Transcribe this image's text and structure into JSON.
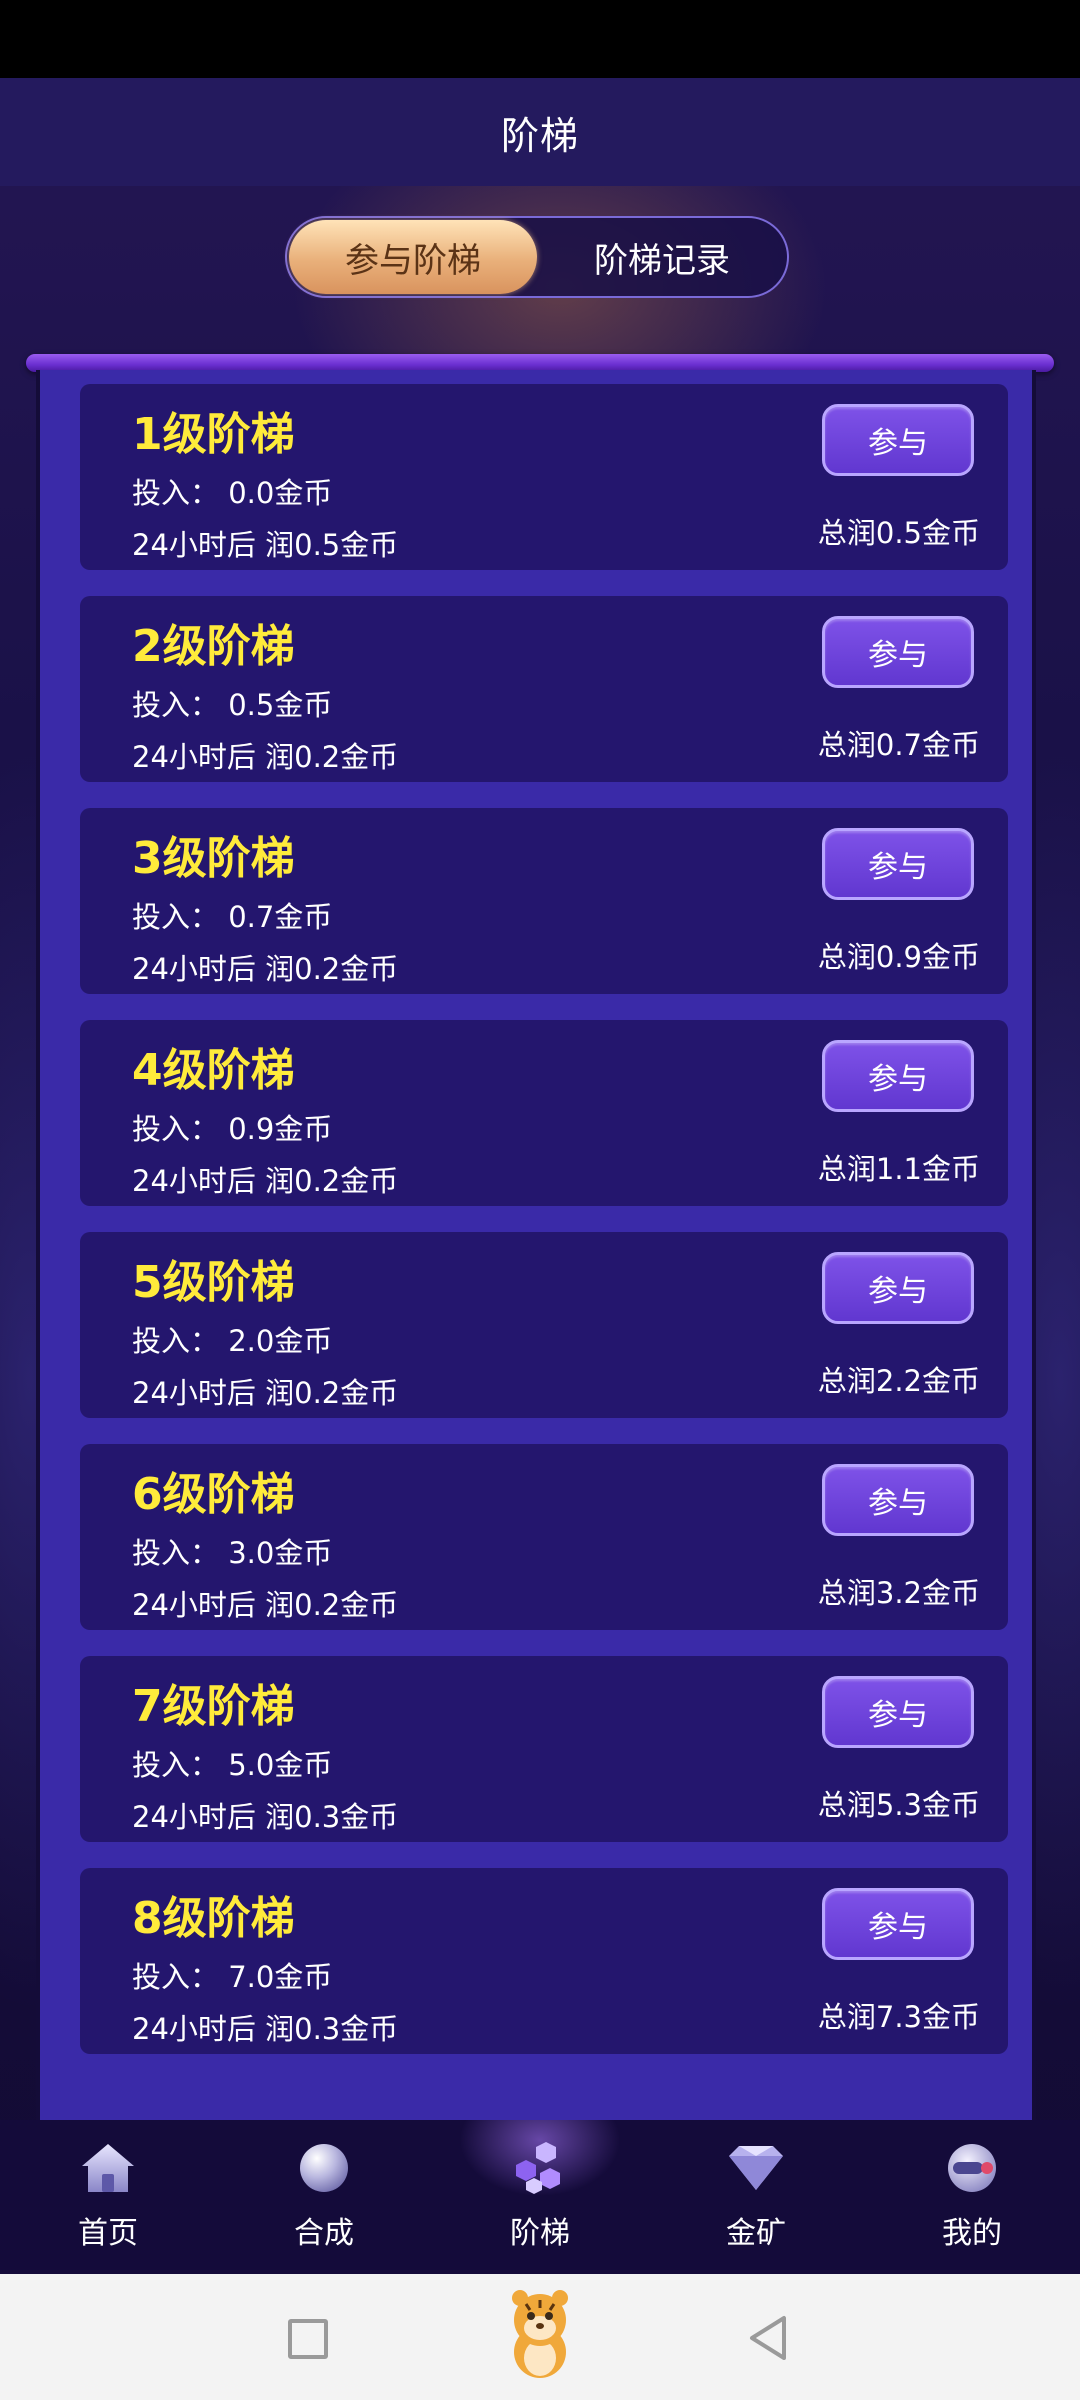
{
  "header": {
    "title": "阶梯"
  },
  "tabs": {
    "join": "参与阶梯",
    "records": "阶梯记录",
    "active": "join"
  },
  "levels": [
    {
      "title": "1级阶梯",
      "invest": "投入：  0.0金币",
      "profit": "24小时后 润0.5金币",
      "total": "总润0.5金币",
      "button": "参与"
    },
    {
      "title": "2级阶梯",
      "invest": "投入：  0.5金币",
      "profit": "24小时后 润0.2金币",
      "total": "总润0.7金币",
      "button": "参与"
    },
    {
      "title": "3级阶梯",
      "invest": "投入：  0.7金币",
      "profit": "24小时后 润0.2金币",
      "total": "总润0.9金币",
      "button": "参与"
    },
    {
      "title": "4级阶梯",
      "invest": "投入：  0.9金币",
      "profit": "24小时后 润0.2金币",
      "total": "总润1.1金币",
      "button": "参与"
    },
    {
      "title": "5级阶梯",
      "invest": "投入：  2.0金币",
      "profit": "24小时后 润0.2金币",
      "total": "总润2.2金币",
      "button": "参与"
    },
    {
      "title": "6级阶梯",
      "invest": "投入：  3.0金币",
      "profit": "24小时后 润0.2金币",
      "total": "总润3.2金币",
      "button": "参与"
    },
    {
      "title": "7级阶梯",
      "invest": "投入：  5.0金币",
      "profit": "24小时后 润0.3金币",
      "total": "总润5.3金币",
      "button": "参与"
    },
    {
      "title": "8级阶梯",
      "invest": "投入：  7.0金币",
      "profit": "24小时后 润0.3金币",
      "total": "总润7.3金币",
      "button": "参与"
    }
  ],
  "nav": [
    {
      "label": "首页",
      "icon": "home-icon"
    },
    {
      "label": "合成",
      "icon": "orb-icon"
    },
    {
      "label": "阶梯",
      "icon": "cubes-icon"
    },
    {
      "label": "金矿",
      "icon": "diamond-icon"
    },
    {
      "label": "我的",
      "icon": "helmet-icon"
    }
  ],
  "nav_active": "阶梯",
  "colors": {
    "accent_gold": "#ffeb3b",
    "card_bg": "#24166e",
    "panel_bg": "#3a2aa8",
    "button": "#6f44dc"
  }
}
